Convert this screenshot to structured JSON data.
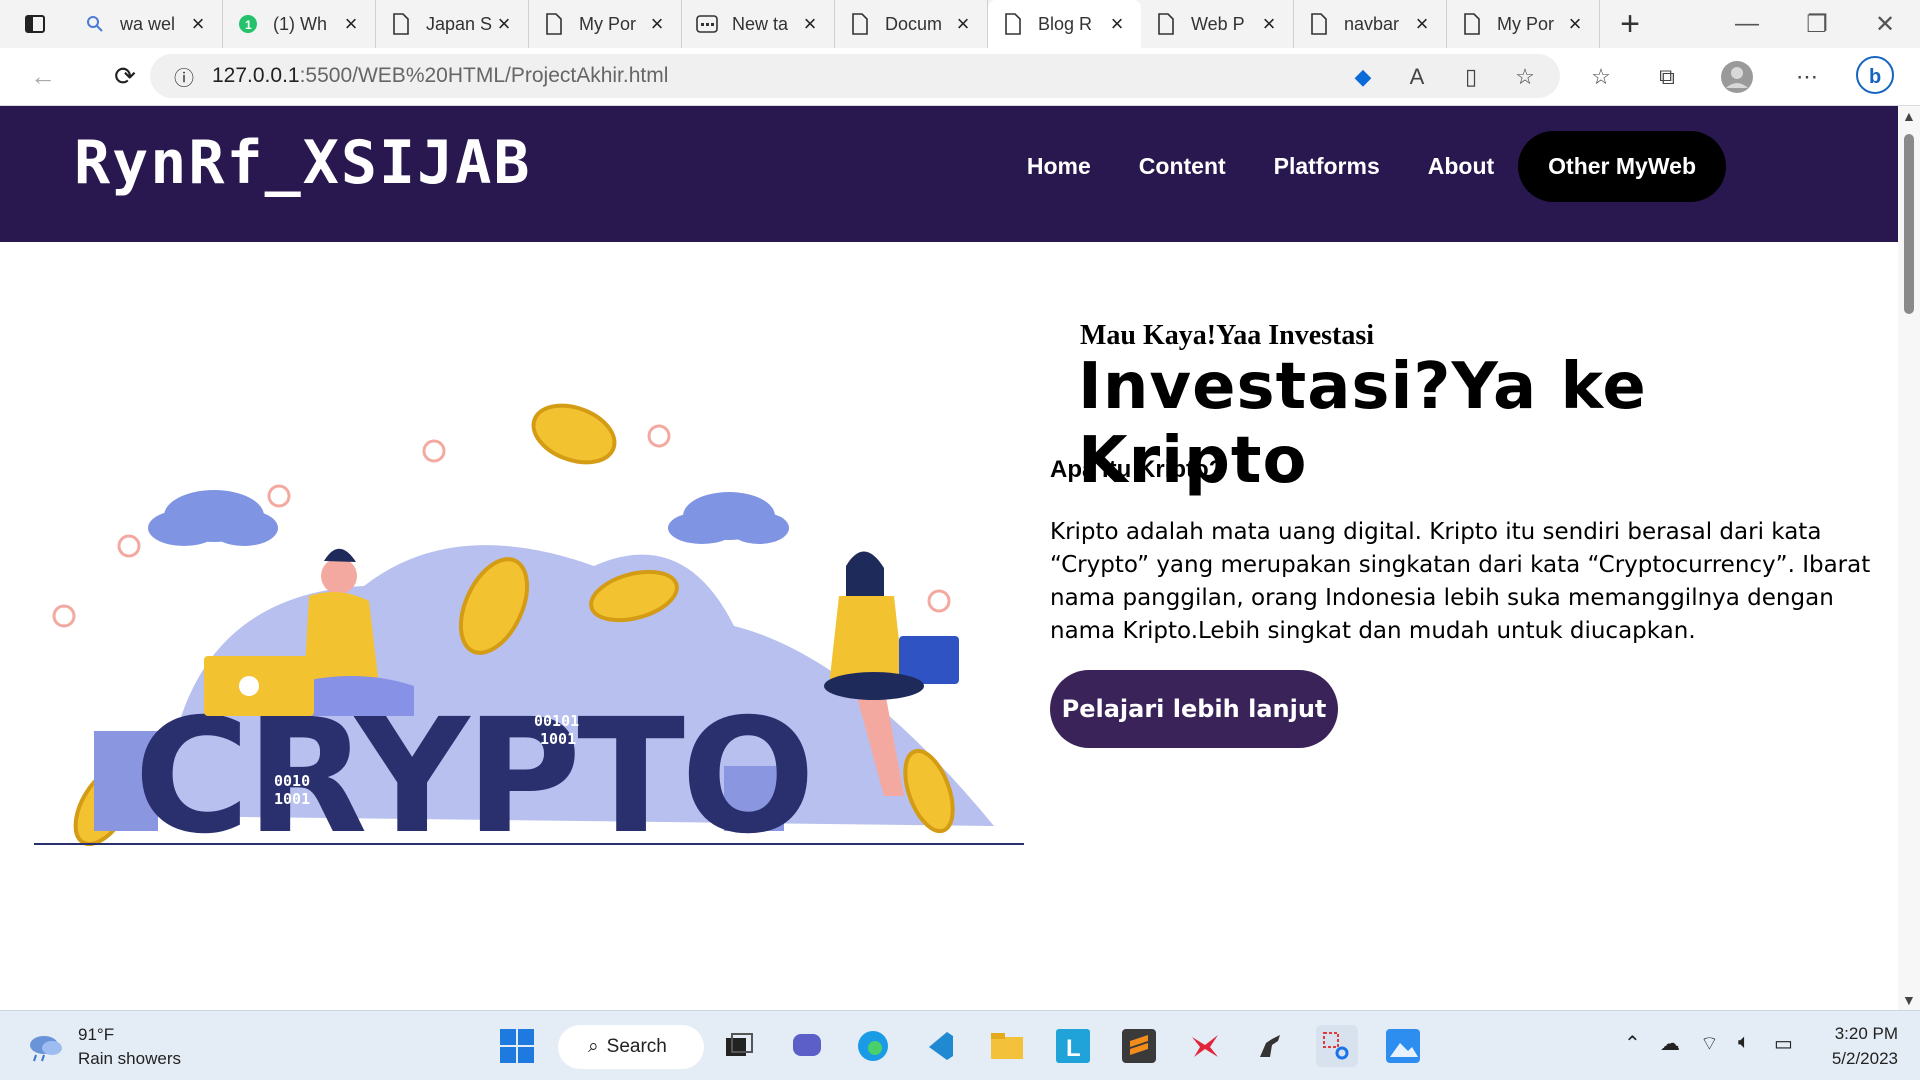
{
  "browser": {
    "tabs": [
      {
        "label": "wa wel",
        "icon": "search-icon"
      },
      {
        "label": "(1) Wh",
        "icon": "whatsapp-icon"
      },
      {
        "label": "Japan S",
        "icon": "page-icon"
      },
      {
        "label": "My Por",
        "icon": "page-icon"
      },
      {
        "label": "New ta",
        "icon": "newtab-icon"
      },
      {
        "label": "Docum",
        "icon": "page-icon"
      },
      {
        "label": "Blog R",
        "icon": "page-icon",
        "active": true
      },
      {
        "label": "Web P",
        "icon": "page-icon"
      },
      {
        "label": "navbar",
        "icon": "page-icon"
      },
      {
        "label": "My Por",
        "icon": "page-icon"
      }
    ],
    "url_host": "127.0.0.1",
    "url_path": ":5500/WEB%20HTML/ProjectAkhir.html"
  },
  "site": {
    "logo": "RynRf_XSIJAB",
    "nav": [
      "Home",
      "Content",
      "Platforms",
      "About"
    ],
    "nav_cta": "Other MyWeb",
    "hero": {
      "subtitle": "Mau Kaya!Yaa Investasi",
      "title": "Investasi?Ya ke Kripto",
      "question": "Apa Itu Kripto?",
      "paragraph": "Kripto adalah mata uang digital. Kripto itu sendiri berasal dari kata “Crypto” yang merupakan singkatan dari kata “Cryptocurrency”. Ibarat nama panggilan, orang Indonesia lebih suka memanggilnya dengan nama Kripto.Lebih singkat dan mudah untuk diucapkan.",
      "button": "Pelajari lebih lanjut",
      "illustration_word": "CRYPTO",
      "binary_1": "00101",
      "binary_2": "1001",
      "binary_3": "0010",
      "binary_4": "1001"
    },
    "colors": {
      "header": "#29174f",
      "cta": "#3a2358",
      "pill": "#000000"
    }
  },
  "taskbar": {
    "temperature": "91°F",
    "condition": "Rain showers",
    "search": "Search",
    "time": "3:20 PM",
    "date": "5/2/2023"
  }
}
